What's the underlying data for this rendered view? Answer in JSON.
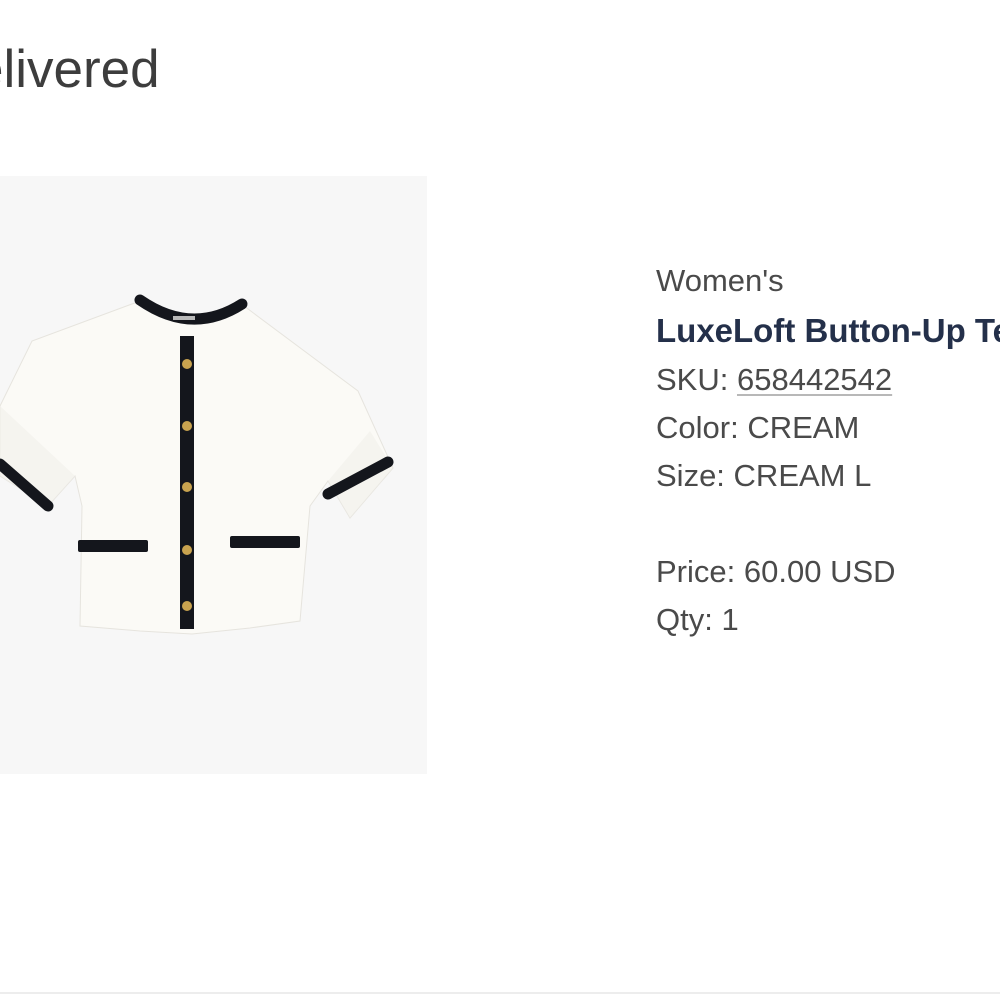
{
  "status": {
    "heading": "elivered"
  },
  "product": {
    "image_name": "cardigan-tee-image",
    "category": "Women's",
    "name": "LuxeLoft Button-Up Tee",
    "sku_label": "SKU:",
    "sku_value": "658442542",
    "color_label": "Color:",
    "color_value": "CREAM",
    "size_label": "Size:",
    "size_value": "CREAM L",
    "price_label": "Price:",
    "price_value": "60.00 USD",
    "qty_label": "Qty:",
    "qty_value": "1"
  },
  "colors": {
    "title_navy": "#24304a",
    "garment_cream": "#fbfaf6",
    "garment_trim": "#14161c",
    "button_gold": "#c9a34f"
  }
}
